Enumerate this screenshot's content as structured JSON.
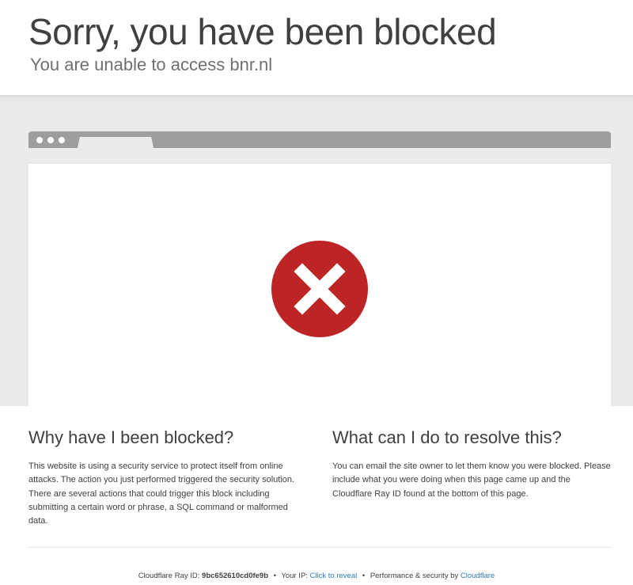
{
  "header": {
    "title": "Sorry, you have been blocked",
    "subtitle": "You are unable to access bnr.nl"
  },
  "colors": {
    "error_red": "#bd2426",
    "link_blue": "#2f7bbf",
    "band_gray": "#ebebeb",
    "browser_bar": "#9e9e9e"
  },
  "browser_mock": {
    "icon": "error-x-icon"
  },
  "why": {
    "heading": "Why have I been blocked?",
    "body": "This website is using a security service to protect itself from online attacks. The action you just performed triggered the security solution. There are several actions that could trigger this block including submitting a certain word or phrase, a SQL command or malformed data."
  },
  "resolve": {
    "heading": "What can I do to resolve this?",
    "body": "You can email the site owner to let them know you were blocked. Please include what you were doing when this page came up and the Cloudflare Ray ID found at the bottom of this page."
  },
  "footer": {
    "ray_label": "Cloudflare Ray ID:",
    "ray_id": "9bc652610cd0fe9b",
    "separator": "•",
    "ip_label": "Your IP:",
    "ip_link": "Click to reveal",
    "perf_label": "Performance & security by",
    "cf_link": "Cloudflare"
  }
}
